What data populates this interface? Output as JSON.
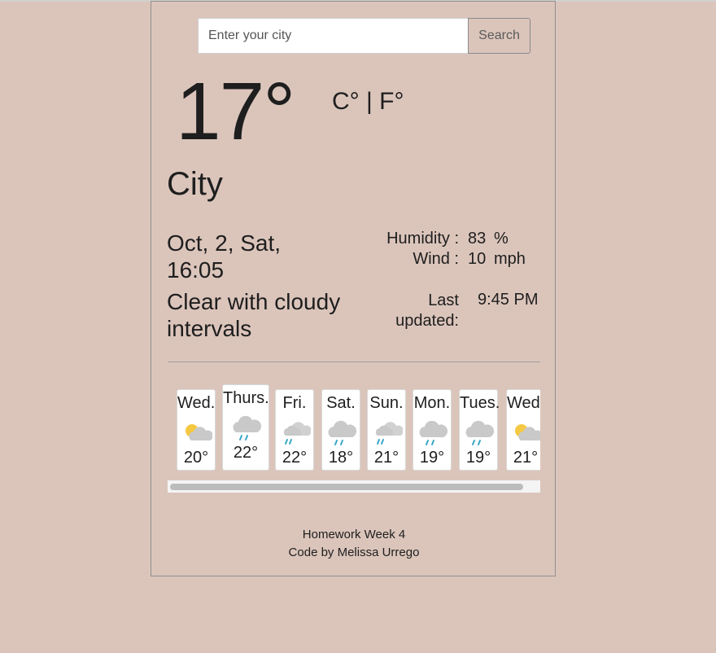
{
  "search": {
    "placeholder": "Enter your city",
    "button_label": "Search"
  },
  "current": {
    "temperature": "17°",
    "unit_celsius": "C°",
    "unit_separator": "|",
    "unit_fahrenheit": "F°",
    "city": "City",
    "date_line1": "Oct, 2, Sat,",
    "date_line2": "16:05",
    "description": "Clear with cloudy intervals",
    "humidity_label": "Humidity :",
    "humidity_value": "83",
    "humidity_unit": "%",
    "wind_label": "Wind :",
    "wind_value": "10",
    "wind_unit": "mph",
    "updated_label": "Last updated:",
    "updated_value": "9:45 PM"
  },
  "forecast": [
    {
      "day": "Wed.",
      "icon": "partly-cloudy-sun-icon",
      "temp": "20°"
    },
    {
      "day": "Thurs.",
      "icon": "rain-cloud-icon",
      "temp": "22°"
    },
    {
      "day": "Fri.",
      "icon": "showers-icon",
      "temp": "22°"
    },
    {
      "day": "Sat.",
      "icon": "rain-cloud-icon",
      "temp": "18°"
    },
    {
      "day": "Sun.",
      "icon": "showers-icon",
      "temp": "21°"
    },
    {
      "day": "Mon.",
      "icon": "rain-cloud-icon",
      "temp": "19°"
    },
    {
      "day": "Tues.",
      "icon": "rain-cloud-icon",
      "temp": "19°"
    },
    {
      "day": "Wed.",
      "icon": "partly-cloudy-sun-icon",
      "temp": "21°"
    }
  ],
  "footer": {
    "line1": "Homework Week 4",
    "line2": "Code by Melissa Urrego"
  },
  "colors": {
    "background": "#dbc5bb",
    "sun": "#f5c842",
    "cloud": "#c9c9c9",
    "rain": "#3aa6c8"
  }
}
